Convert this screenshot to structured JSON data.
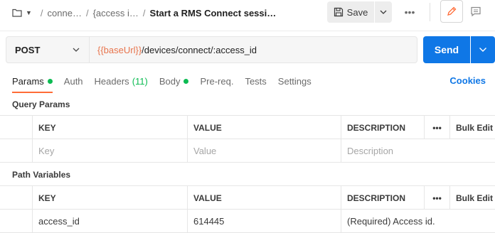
{
  "breadcrumb": {
    "items": [
      "conne…",
      "{access i…"
    ],
    "current": "Start a RMS Connect sessi…"
  },
  "toolbar": {
    "save_label": "Save",
    "more_label": "•••"
  },
  "request": {
    "method": "POST",
    "url_variable": "{{baseUrl}}",
    "url_path": "/devices/connect/:access_id",
    "send_label": "Send"
  },
  "tabs": [
    {
      "label": "Params"
    },
    {
      "label": "Auth"
    },
    {
      "label": "Headers",
      "count": "(11)"
    },
    {
      "label": "Body"
    },
    {
      "label": "Pre-req."
    },
    {
      "label": "Tests"
    },
    {
      "label": "Settings"
    }
  ],
  "cookies_label": "Cookies",
  "query_params": {
    "title": "Query Params",
    "headers": {
      "key": "KEY",
      "value": "VALUE",
      "description": "DESCRIPTION",
      "more": "•••",
      "bulk": "Bulk Edit"
    },
    "placeholders": {
      "key": "Key",
      "value": "Value",
      "description": "Description"
    }
  },
  "path_variables": {
    "title": "Path Variables",
    "headers": {
      "key": "KEY",
      "value": "VALUE",
      "description": "DESCRIPTION",
      "more": "•••",
      "bulk": "Bulk Edit"
    },
    "rows": [
      {
        "key": "access_id",
        "value": "614445",
        "description": "(Required) Access id."
      }
    ]
  },
  "colors": {
    "accent": "#ff6c37",
    "send": "#0f77e6",
    "green": "#0cbb52",
    "variable": "#e8744c"
  }
}
